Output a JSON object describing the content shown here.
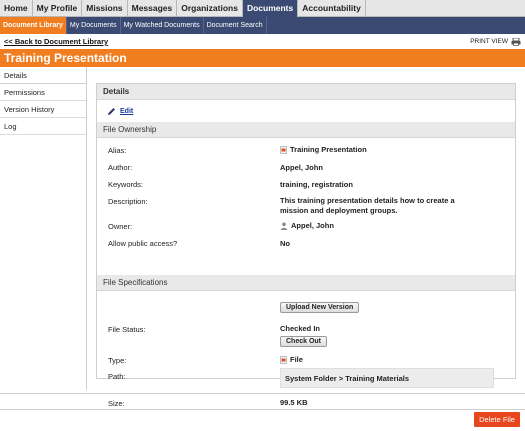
{
  "topnav": {
    "tabs": [
      {
        "label": "Home",
        "active": false
      },
      {
        "label": "My Profile",
        "active": false
      },
      {
        "label": "Missions",
        "active": false
      },
      {
        "label": "Messages",
        "active": false
      },
      {
        "label": "Organizations",
        "active": false
      },
      {
        "label": "Documents",
        "active": true
      },
      {
        "label": "Accountability",
        "active": false
      }
    ]
  },
  "subnav": {
    "items": [
      {
        "label": "Document Library",
        "active": true
      },
      {
        "label": "My Documents",
        "active": false
      },
      {
        "label": "My Watched Documents",
        "active": false
      },
      {
        "label": "Document Search",
        "active": false
      }
    ]
  },
  "backbar": {
    "back_label": "<< Back to Document Library",
    "print_label": "PRINT VIEW"
  },
  "page": {
    "title": "Training Presentation"
  },
  "leftnav": {
    "items": [
      "Details",
      "Permissions",
      "Version History",
      "Log"
    ]
  },
  "details": {
    "header": "Details",
    "edit_label": "Edit",
    "ownership_header": "File Ownership",
    "alias_label": "Alias:",
    "alias_value": "Training Presentation",
    "author_label": "Author:",
    "author_value": "Appel, John",
    "keywords_label": "Keywords:",
    "keywords_value": "training, registration",
    "description_label": "Description:",
    "description_line1": "This training presentation details how to create a",
    "description_line2": "mission and deployment groups.",
    "owner_label": "Owner:",
    "owner_value": "Appel, John",
    "public_label": "Allow public access?",
    "public_value": "No",
    "specs_header": "File Specifications",
    "upload_button": "Upload New Version",
    "status_label": "File Status:",
    "status_value": "Checked In",
    "checkout_button": "Check Out",
    "type_label": "Type:",
    "type_value": "File",
    "path_label": "Path:",
    "path_value": "System Folder > Training Materials",
    "size_label": "Size:",
    "size_value": "99.5 KB"
  },
  "footer": {
    "delete_label": "Delete File"
  },
  "colors": {
    "accent": "#f07d1f",
    "nav": "#3a4a72",
    "delete": "#e8471d"
  }
}
